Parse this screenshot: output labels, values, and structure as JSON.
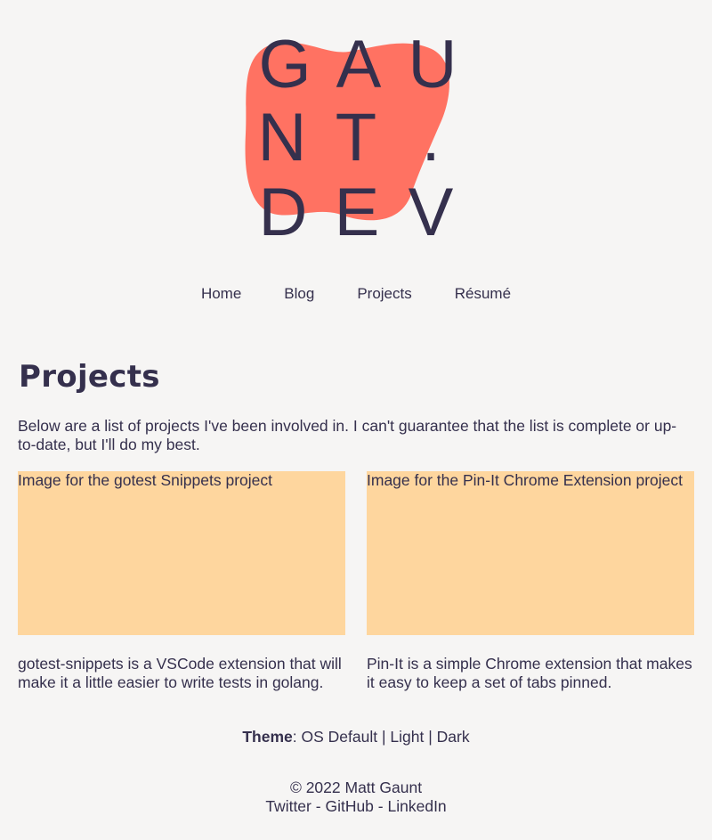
{
  "logo": {
    "row1": [
      "G",
      "A",
      "U"
    ],
    "row2": [
      "N",
      "T",
      "."
    ],
    "row3": [
      "D",
      "E",
      "V"
    ],
    "blob_color": "#ff7262",
    "text_color": "#35304d"
  },
  "nav": {
    "items": [
      {
        "label": "Home"
      },
      {
        "label": "Blog"
      },
      {
        "label": "Projects"
      },
      {
        "label": "Résumé"
      }
    ]
  },
  "main": {
    "title": "Projects",
    "intro": "Below are a list of projects I've been involved in. I can't guarantee that the list is complete or up-to-date, but I'll do my best.",
    "projects": [
      {
        "image_alt": "Image for the gotest Snippets project",
        "description": "gotest-snippets is a VSCode extension that will make it a little easier to write tests in golang."
      },
      {
        "image_alt": "Image for the Pin-It Chrome Extension project",
        "description": "Pin-It is a simple Chrome extension that makes it easy to keep a set of tabs pinned."
      }
    ]
  },
  "theme": {
    "label": "Theme",
    "separator": ":",
    "options": [
      "OS Default",
      "Light",
      "Dark"
    ],
    "divider": "|"
  },
  "footer": {
    "copyright": "© 2022 Matt Gaunt",
    "links": [
      "Twitter",
      "GitHub",
      "LinkedIn"
    ],
    "link_separator": "-"
  },
  "colors": {
    "background": "#f6f5f4",
    "text": "#35304d",
    "accent": "#ff7262",
    "card_placeholder": "#fed69e"
  }
}
